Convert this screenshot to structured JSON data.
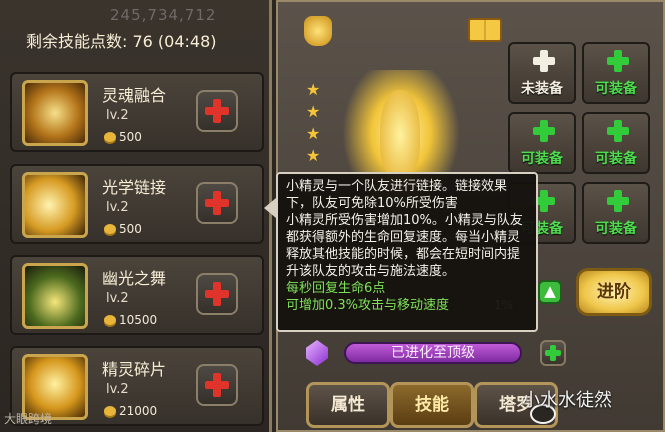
{
  "header": {
    "top_number": "245,734,712",
    "skill_points_text": "剩余技能点数: 76 (04:48)"
  },
  "skills": [
    {
      "name": "灵魂融合",
      "level": "lv.2",
      "cost": "500",
      "icon": "soul-fusion-icon"
    },
    {
      "name": "光学链接",
      "level": "lv.2",
      "cost": "500",
      "icon": "optical-link-icon"
    },
    {
      "name": "幽光之舞",
      "level": "lv.2",
      "cost": "10500",
      "icon": "ghost-light-dance-icon"
    },
    {
      "name": "精灵碎片",
      "level": "lv.2",
      "cost": "21000",
      "icon": "spirit-shard-icon"
    }
  ],
  "tooltip": {
    "description": "小精灵与一个队友进行链接。链接效果下，队友可免除10%所受伤害\n    小精灵所受伤害增加10%。小精灵与队友都获得额外的生命回复速度。每当小精灵释放其他技能的时候，都会在短时间内提升该队友的攻击与施法速度。",
    "bonus_line1": "每秒回复生命6点",
    "bonus_line2": "可增加0.3%攻击与移动速度"
  },
  "equipment": {
    "slots": [
      {
        "label": "未装备",
        "state": "unequipped"
      },
      {
        "label": "可装备",
        "state": "equippable"
      },
      {
        "label": "可装备",
        "state": "equippable"
      },
      {
        "label": "可装备",
        "state": "equippable"
      },
      {
        "label": "可装备",
        "state": "equippable"
      },
      {
        "label": "可装备",
        "state": "equippable"
      }
    ],
    "advance_label": "进阶"
  },
  "hero": {
    "stars": 4,
    "xp_percent": "1%",
    "evolution_text": "已进化至顶级"
  },
  "tabs": [
    {
      "label": "属性",
      "active": false
    },
    {
      "label": "技能",
      "active": true
    },
    {
      "label": "塔罗",
      "active": false
    }
  ],
  "watermarks": {
    "left": "大眼跨境",
    "right": "小水水徒然"
  },
  "colors": {
    "accent_gold": "#c9a64d",
    "plus_red": "#e0332a",
    "plus_green": "#32cc3a",
    "evolved_purple": "#9b3fc0"
  }
}
